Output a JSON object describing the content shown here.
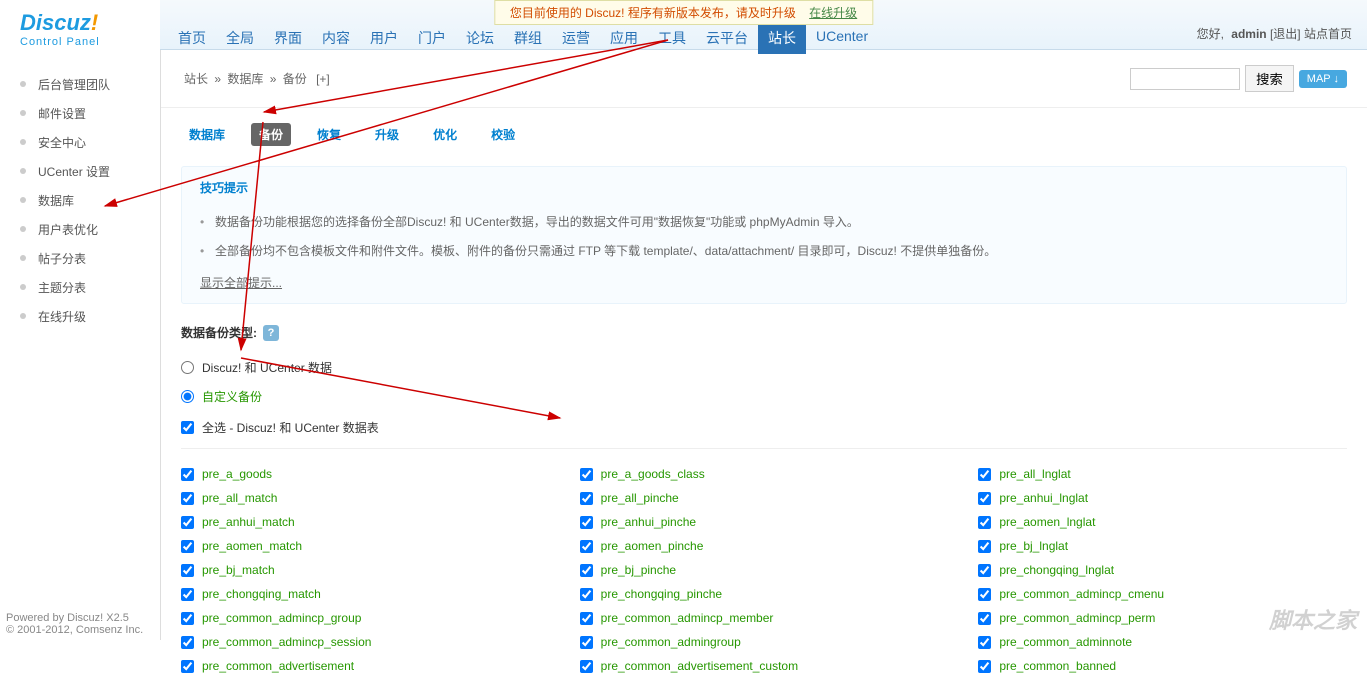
{
  "notice": {
    "text": "您目前使用的 Discuz! 程序有新版本发布，请及时升级",
    "link": "在线升级"
  },
  "logo": {
    "main": "Discuz",
    "sub": "Control Panel"
  },
  "nav": [
    "首页",
    "全局",
    "界面",
    "内容",
    "用户",
    "门户",
    "论坛",
    "群组",
    "运营",
    "应用",
    "工具",
    "云平台",
    "站长",
    "UCenter"
  ],
  "nav_active": 12,
  "user": {
    "greeting": "您好,",
    "name": "admin",
    "logout": "[退出]",
    "home": "站点首页"
  },
  "sidebar": [
    "后台管理团队",
    "邮件设置",
    "安全中心",
    "UCenter 设置",
    "数据库",
    "用户表优化",
    "帖子分表",
    "主题分表",
    "在线升级"
  ],
  "breadcrumb": {
    "parts": [
      "站长",
      "数据库",
      "备份"
    ],
    "add": "[+]"
  },
  "search": {
    "btn": "搜索",
    "map": "MAP ↓"
  },
  "subnav": [
    "数据库",
    "备份",
    "恢复",
    "升级",
    "优化",
    "校验"
  ],
  "subnav_active": 1,
  "tips": {
    "title": "技巧提示",
    "items": [
      "数据备份功能根据您的选择备份全部Discuz! 和 UCenter数据，导出的数据文件可用\"数据恢复\"功能或 phpMyAdmin 导入。",
      "全部备份均不包含模板文件和附件文件。模板、附件的备份只需通过 FTP 等下载 template/、data/attachment/ 目录即可，Discuz! 不提供单独备份。"
    ],
    "show_all": "显示全部提示..."
  },
  "backup_type": {
    "label": "数据备份类型:",
    "options": [
      "Discuz! 和 UCenter 数据",
      "自定义备份"
    ],
    "selected": 1
  },
  "select_all": "全选 - Discuz! 和 UCenter 数据表",
  "tables": [
    [
      "pre_a_goods",
      "pre_a_goods_class",
      "pre_all_lnglat"
    ],
    [
      "pre_all_match",
      "pre_all_pinche",
      "pre_anhui_lnglat"
    ],
    [
      "pre_anhui_match",
      "pre_anhui_pinche",
      "pre_aomen_lnglat"
    ],
    [
      "pre_aomen_match",
      "pre_aomen_pinche",
      "pre_bj_lnglat"
    ],
    [
      "pre_bj_match",
      "pre_bj_pinche",
      "pre_chongqing_lnglat"
    ],
    [
      "pre_chongqing_match",
      "pre_chongqing_pinche",
      "pre_common_admincp_cmenu"
    ],
    [
      "pre_common_admincp_group",
      "pre_common_admincp_member",
      "pre_common_admincp_perm"
    ],
    [
      "pre_common_admincp_session",
      "pre_common_admingroup",
      "pre_common_adminnote"
    ],
    [
      "pre_common_advertisement",
      "pre_common_advertisement_custom",
      "pre_common_banned"
    ]
  ],
  "footer": {
    "powered": "Powered by Discuz! X2.5",
    "copyright": "© 2001-2012, Comsenz Inc."
  },
  "watermark": "脚本之家"
}
